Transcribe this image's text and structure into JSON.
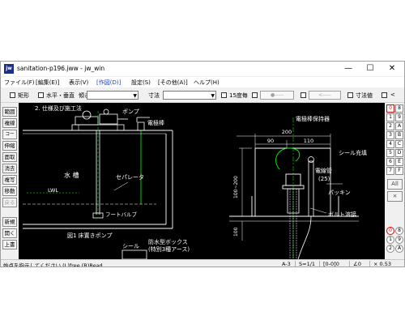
{
  "window": {
    "title": "sanitation-p196.jww - jw_win",
    "app_icon_text": "jw",
    "controls": {
      "minimize": "—",
      "maximize": "☐",
      "close": "✕"
    }
  },
  "menubar": [
    "ファイル(F)",
    "[編集(E)]",
    "表示(V)",
    "[作図(D)]",
    "設定(S)",
    "[その他(A)]",
    "ヘルプ(H)"
  ],
  "toolbar": {
    "rect_label": "矩形",
    "hv_label": "水平・垂直",
    "slope_label": "傾き",
    "dim_label": "寸法",
    "deg15_label": "15度毎",
    "dots_label": "●-----",
    "dashes_label": "<-----",
    "dimval_label": "寸法値",
    "lt_label": "<"
  },
  "left_tools": [
    "範囲",
    "複線",
    "コーナー",
    "伸縮",
    "面取",
    "消去",
    "複写",
    "移動",
    "戻る",
    "新規",
    "開く",
    "上書"
  ],
  "right_panel": {
    "row_labels_left": [
      "0",
      "1",
      "2",
      "3",
      "4",
      "5",
      "6",
      "7"
    ],
    "row_labels_right": [
      "8",
      "9",
      "A",
      "B",
      "C",
      "D",
      "E",
      "F"
    ],
    "all_label": "All",
    "x_label": "×",
    "bottom_left": [
      "0",
      "1",
      "2"
    ],
    "bottom_right": [
      "8",
      "9",
      "A"
    ]
  },
  "drawing": {
    "heading": "2. 仕様及び施工法",
    "pump_label": "ポンプ",
    "electrode_label": "電極棒",
    "tank_label": "水 槽",
    "separator_label": "セパレータ",
    "lwl_label": "LWL",
    "foot_valve_label": "フートバルブ",
    "figure_caption": "図1  床置きポンプ",
    "seal_label": "シール",
    "box_label_1": "防水型ボックス",
    "box_label_2": "(特別3種アース)",
    "holder_label": "電極棒保持器",
    "dim_200": "200",
    "dim_90": "90",
    "dim_110": "110",
    "seal_fill_label": "シール充填",
    "tube_label_1": "電線管",
    "tube_label_2": "(25)",
    "packing_label": "パッキン",
    "bolt_label": "ボルト溶接",
    "dim_vertical": "100~200",
    "dim_100": "100"
  },
  "status": {
    "hint": "始点を指示してください (L)free (R)Read",
    "scale_sheet": "A-3",
    "scale": "S=1/1",
    "layer": "[0-0]0",
    "angle": "∠0",
    "zoom": "× 0.53"
  }
}
